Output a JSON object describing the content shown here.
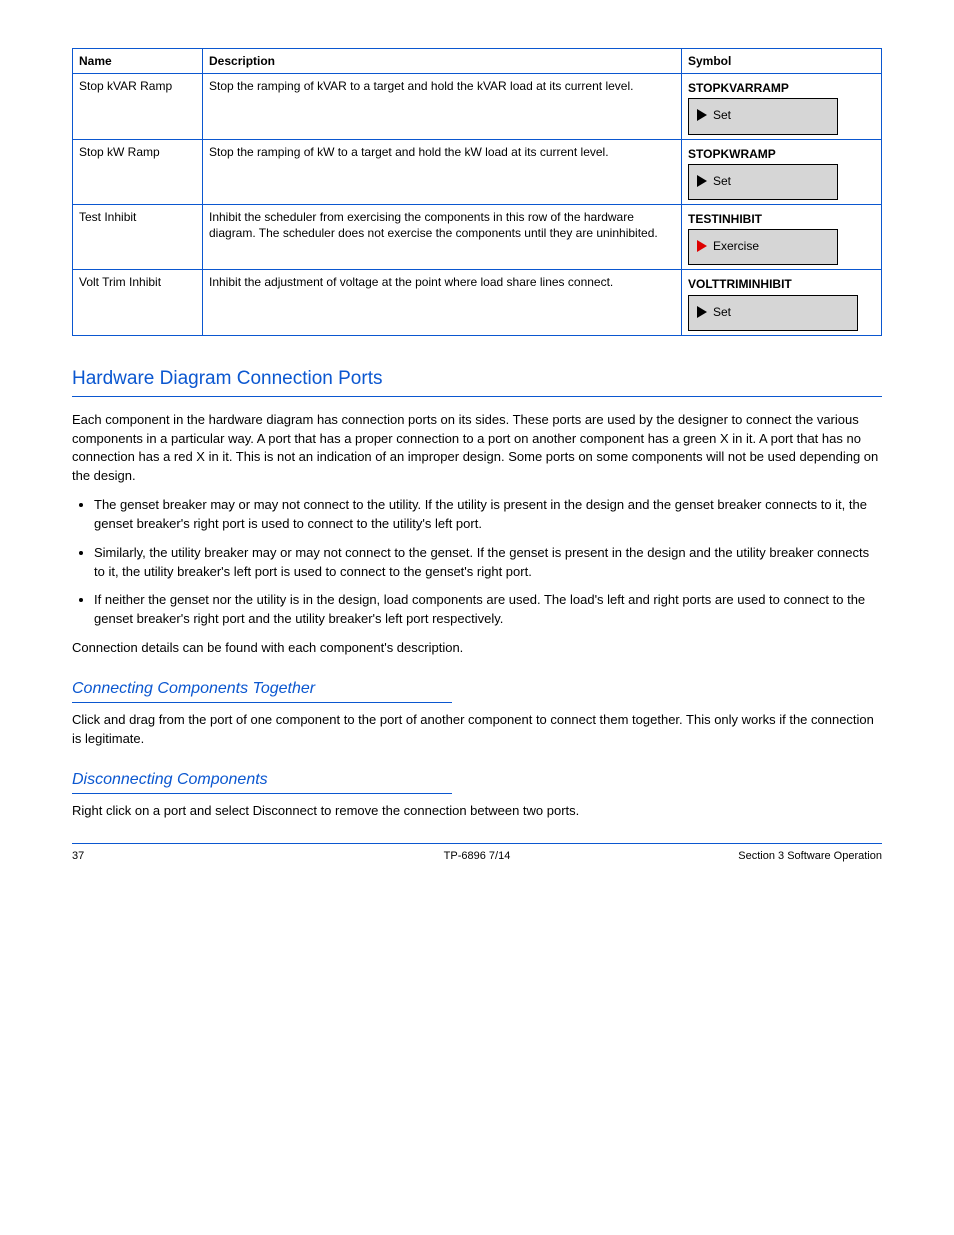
{
  "table": {
    "headers": [
      "Name",
      "Description",
      "Symbol"
    ],
    "rows": [
      {
        "name": "Stop kVAR Ramp",
        "desc": "Stop the ramping of kVAR to a target and hold the kVAR load at its current level.",
        "symbol": {
          "title": "STOPKVARRAMP",
          "label": "Set",
          "red": false,
          "wide": false
        }
      },
      {
        "name": "Stop kW Ramp",
        "desc": "Stop the ramping of kW to a target and hold the kW load at its current level.",
        "symbol": {
          "title": "STOPKWRAMP",
          "label": "Set",
          "red": false,
          "wide": false
        }
      },
      {
        "name": "Test Inhibit",
        "desc": "Inhibit the scheduler from exercising the components in this row of the hardware diagram. The scheduler does not exercise the components until they are uninhibited.",
        "symbol": {
          "title": "TESTINHIBIT",
          "label": "Exercise",
          "red": true,
          "wide": false
        }
      },
      {
        "name": "Volt Trim Inhibit",
        "desc": "Inhibit the adjustment of voltage at the point where load share lines connect.",
        "symbol": {
          "title": "VOLTTRIMINHIBIT",
          "label": "Set",
          "red": false,
          "wide": true
        }
      }
    ]
  },
  "section_title": "Hardware Diagram Connection Ports",
  "intro": "Each component in the hardware diagram has connection ports on its sides. These ports are used by the designer to connect the various components in a particular way. A port that has a proper connection to a port on another component has a green X in it. A port that has no connection has a red X in it. This is not an indication of an improper design. Some ports on some components will not be used depending on the design.",
  "cases": [
    "The genset breaker may or may not connect to the utility. If the utility is present in the design and the genset breaker connects to it, the genset breaker's right port is used to connect to the utility's left port.",
    "Similarly, the utility breaker may or may not connect to the genset. If the genset is present in the design and the utility breaker connects to it, the utility breaker's left port is used to connect to the genset's right port.",
    "If neither the genset nor the utility is in the design, load components are used. The load's left and right ports are used to connect to the genset breaker's right port and the utility breaker's left port respectively."
  ],
  "conn_details": "Connection details can be found with each component's description.",
  "sub1_title": "Connecting Components Together",
  "sub1_body": "Click and drag from the port of one component to the port of another component to connect them together. This only works if the connection is legitimate.",
  "sub2_title": "Disconnecting Components",
  "sub2_body": "Right click on a port and select Disconnect to remove the connection between two ports.",
  "footer": {
    "left": "37",
    "center": "TP-6896 7/14",
    "right": "Section 3 Software Operation"
  }
}
